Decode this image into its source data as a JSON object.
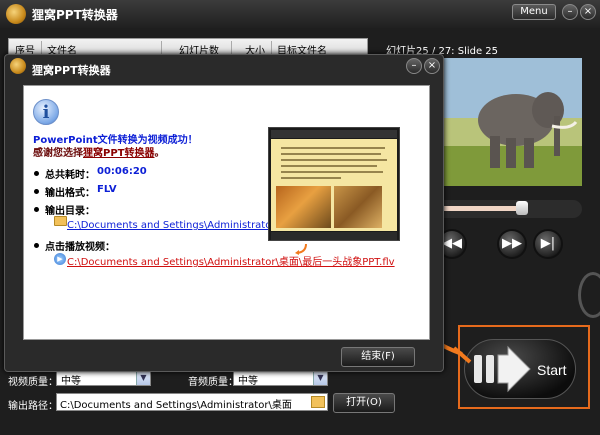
{
  "app": {
    "title": "狸窝PPT转换器",
    "menu_label": "Menu",
    "minimize_symbol": "–",
    "close_symbol": "×"
  },
  "table": {
    "headers": [
      "序号",
      "文件名",
      "幻灯片数",
      "大小",
      "目标文件名"
    ]
  },
  "preview": {
    "slide_info": "幻灯片25 / 27: Slide 25",
    "progress": 0.6
  },
  "player": {
    "prev_symbol": "◀◀",
    "ff_symbol": "▶▶",
    "next_symbol": "▶|"
  },
  "dialog": {
    "title": "狸窝PPT转换器",
    "minimize_symbol": "–",
    "close_symbol": "×",
    "info_symbol": "i",
    "success_message": "PowerPoint文件转换为视频成功！",
    "thanks_prefix": "感谢您选择",
    "thanks_brand": "狸窝PPT转换器",
    "thanks_suffix": "。",
    "total_time_label": "总共耗时：",
    "total_time_value": "00:06:20",
    "output_format_label": "输出格式：",
    "output_format_value": "FLV",
    "output_dir_label": "输出目录：",
    "output_dir_value": "C:\\Documents and Settings\\Administrator\\桌面",
    "play_video_label": "点击播放视频：",
    "play_video_value": "C:\\Documents and Settings\\Administrator\\桌面\\最后一头战象PPT.flv",
    "finish_button": "结束(F)"
  },
  "settings": {
    "video_quality_label": "视频质量：",
    "video_quality_value": "中等",
    "audio_quality_label": "音频质量：",
    "audio_quality_value": "中等",
    "output_path_label": "输出路径：",
    "output_path_value": "C:\\Documents and Settings\\Administrator\\桌面",
    "open_button": "打开(O)"
  },
  "start": {
    "label": "Start"
  },
  "colors": {
    "accent": "#e66a1c",
    "link_blue": "#0c1fd6",
    "link_red": "#d01010"
  }
}
